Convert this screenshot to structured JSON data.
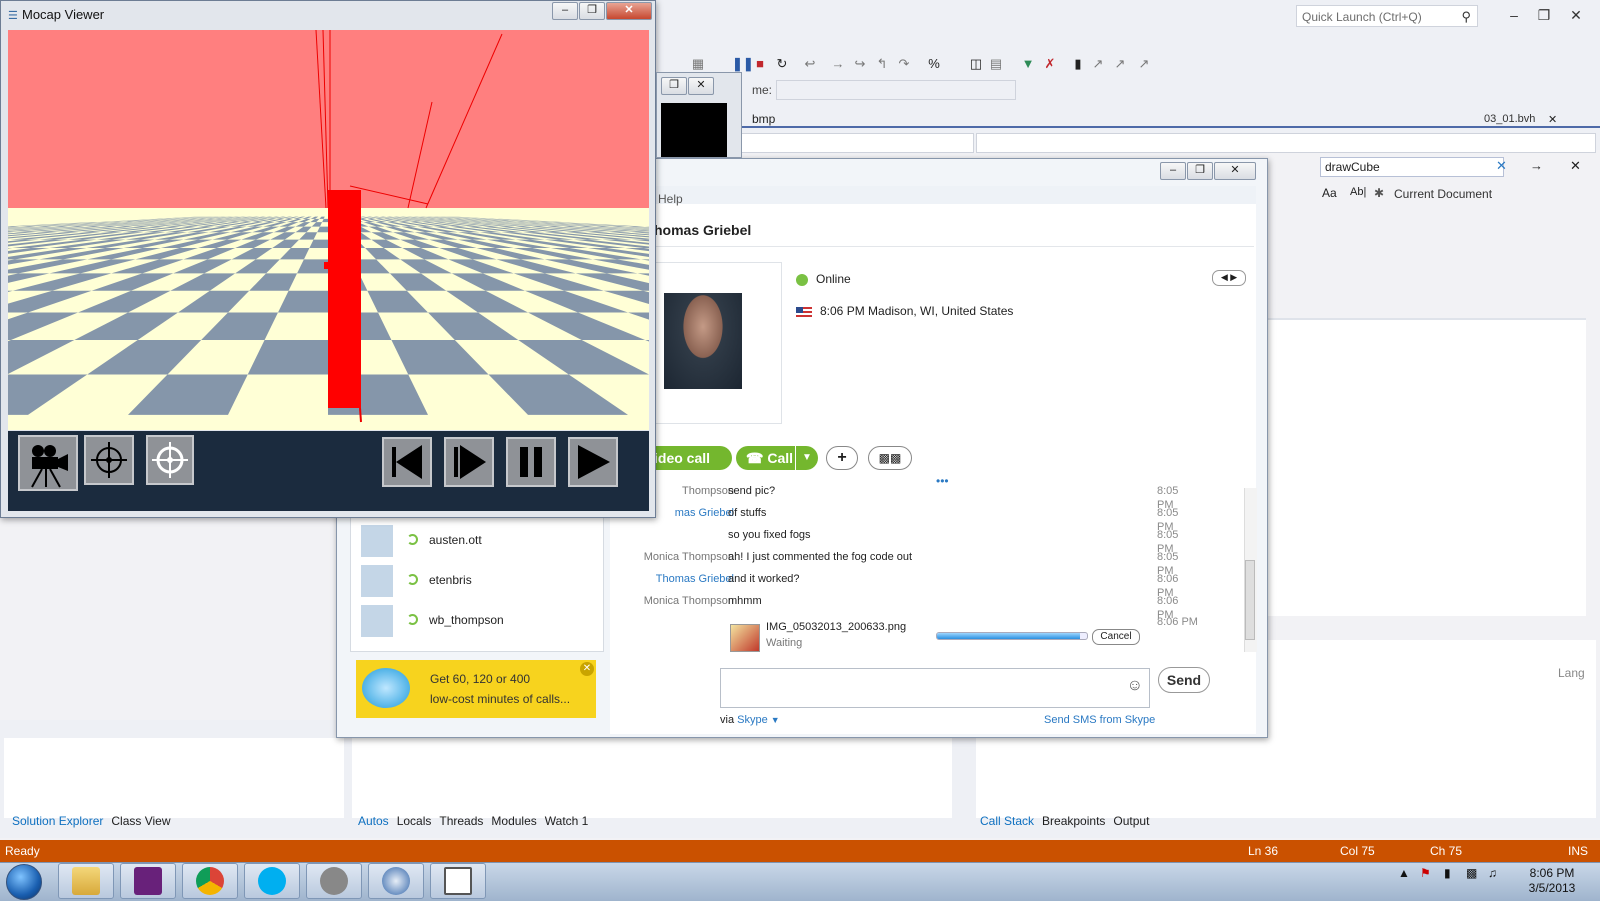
{
  "vs": {
    "quick_launch_placeholder": "Quick Launch (Ctrl+Q)",
    "doc_tab": "bmp",
    "doc_tab_right": "03_01.bvh",
    "label_me": "me:",
    "find_text": "drawCube",
    "find_scope": "Current Document",
    "find_opt_case": "Aa",
    "find_opt_word": "Ab|",
    "left_tabs": [
      "Solution Explorer",
      "Class View"
    ],
    "mid_tabs": [
      "Autos",
      "Locals",
      "Threads",
      "Modules",
      "Watch 1"
    ],
    "right_tabs": [
      "Call Stack",
      "Breakpoints",
      "Output"
    ],
    "lang_label": "Lang",
    "status": {
      "ready": "Ready",
      "ln": "Ln 36",
      "col": "Col 75",
      "ch": "Ch 75",
      "ins": "INS"
    }
  },
  "mocap": {
    "title": "Mocap Viewer"
  },
  "skype": {
    "menu_help": "Help",
    "contact_name": "homas Griebel",
    "status": "Online",
    "location": "8:06 PM Madison, WI, United States",
    "video_call_label": "ideo call",
    "call_label": "Call",
    "plus_label": "+",
    "chat": [
      {
        "who": "Thompson",
        "self": false,
        "msg": "send pic?",
        "time": "8:05 PM"
      },
      {
        "who": "mas Griebel",
        "self": true,
        "msg": "of stuffs",
        "time": "8:05 PM"
      },
      {
        "who": "",
        "self": false,
        "msg": "so you fixed fogs",
        "time": "8:05 PM"
      },
      {
        "who": "Monica Thompson",
        "self": false,
        "msg": "ah!  I just commented the fog code out",
        "time": "8:05 PM"
      },
      {
        "who": "Thomas Griebel",
        "self": true,
        "msg": "and it worked?",
        "time": "8:06 PM"
      },
      {
        "who": "Monica Thompson",
        "self": false,
        "msg": "mhmm",
        "time": "8:06 PM"
      }
    ],
    "file": {
      "name": "IMG_05032013_200633.png",
      "status": "Waiting",
      "time": "8:06 PM",
      "cancel": "Cancel",
      "progress": 0.95
    },
    "contacts": [
      "austen.ott",
      "etenbris",
      "wb_thompson"
    ],
    "promo_line1": "Get 60, 120 or 400",
    "promo_line2": "low-cost minutes of calls...",
    "send_label": "Send",
    "via_label": "via",
    "via_skype": "Skype",
    "sms_link": "Send SMS from Skype"
  },
  "taskbar": {
    "time": "8:06 PM",
    "date": "3/5/2013"
  },
  "colors": {
    "accent_vs": "#ca5100",
    "skype_green": "#74b72e",
    "sky": "#ff7f7f",
    "floor_light": "#ffffd6",
    "floor_dark": "#8596aa"
  }
}
